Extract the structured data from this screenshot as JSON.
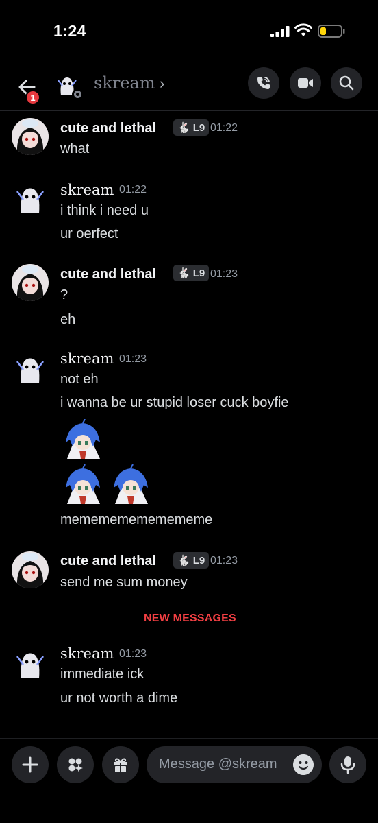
{
  "status_bar": {
    "time": "1:24"
  },
  "header": {
    "title": "skream",
    "unread_badge": "1",
    "icons": [
      "back-arrow-icon",
      "phone-icon",
      "video-icon",
      "search-icon"
    ]
  },
  "messages": [
    {
      "author": "cute and lethal",
      "tag": "L9",
      "time": "01:22",
      "lines": [
        "what"
      ]
    },
    {
      "author": "skream",
      "time": "01:22",
      "lines": [
        "i think i need u",
        "ur oerfect"
      ]
    },
    {
      "author": "cute and lethal",
      "tag": "L9",
      "time": "01:23",
      "lines": [
        "?",
        "eh"
      ]
    },
    {
      "author": "skream",
      "time": "01:23",
      "lines": [
        "not eh",
        "i wanna be ur stupid loser cuck boyfie",
        "memememememememe"
      ]
    },
    {
      "author": "cute and lethal",
      "tag": "L9",
      "time": "01:23",
      "lines": [
        "send me sum money"
      ]
    },
    {
      "author": "skream",
      "time": "01:23",
      "lines": [
        "immediate ick",
        "ur not worth a dime"
      ]
    }
  ],
  "new_messages_label": "NEW MESSAGES",
  "composer": {
    "placeholder": "Message @skream"
  },
  "colors": {
    "accent_red": "#f23f43",
    "button_bg": "#232428",
    "muted_text": "#949ba4"
  }
}
